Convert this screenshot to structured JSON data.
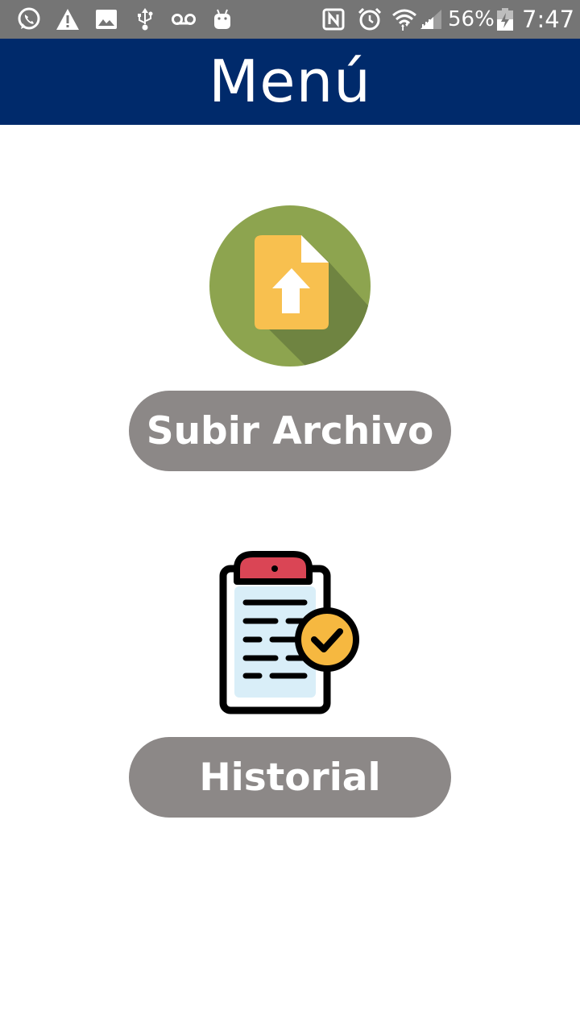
{
  "status_bar": {
    "left_icons": [
      "whatsapp-icon",
      "warning-icon",
      "image-icon",
      "usb-icon",
      "voicemail-icon",
      "android-icon"
    ],
    "right_icons": [
      "nfc-icon",
      "alarm-icon",
      "wifi-icon",
      "signal-icon",
      "battery-icon"
    ],
    "battery_percent": "56%",
    "time": "7:47"
  },
  "app_bar": {
    "title": "Menú",
    "color": "#002a6b"
  },
  "menu": {
    "items": [
      {
        "icon": "upload-file-icon",
        "label": "Subir Archivo"
      },
      {
        "icon": "clipboard-check-icon",
        "label": "Historial"
      }
    ],
    "button_color": "#8c8887"
  }
}
